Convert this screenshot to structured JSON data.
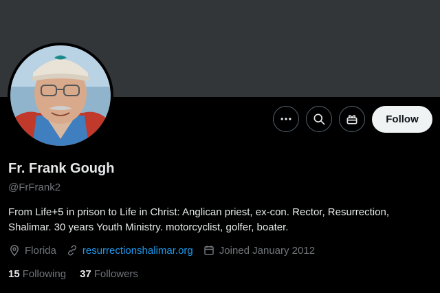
{
  "profile": {
    "name": "Fr. Frank Gough",
    "handle": "@FrFrank2",
    "bio": "From Life+5 in prison to Life in Christ: Anglican priest, ex-con. Rector, Resurrection, Shalimar. 30 years Youth Ministry. motorcyclist, golfer, boater.",
    "location": "Florida",
    "website": "resurrectionshalimar.org",
    "joined": "Joined January 2012",
    "following_count": "15",
    "following_label": "Following",
    "followers_count": "37",
    "followers_label": "Followers"
  },
  "actions": {
    "follow_label": "Follow",
    "icons": [
      "more-icon",
      "search-icon",
      "gift-icon"
    ]
  },
  "colors": {
    "banner": "#333639",
    "link": "#1d9bf0",
    "muted": "#71767b",
    "text": "#e7e9ea"
  }
}
